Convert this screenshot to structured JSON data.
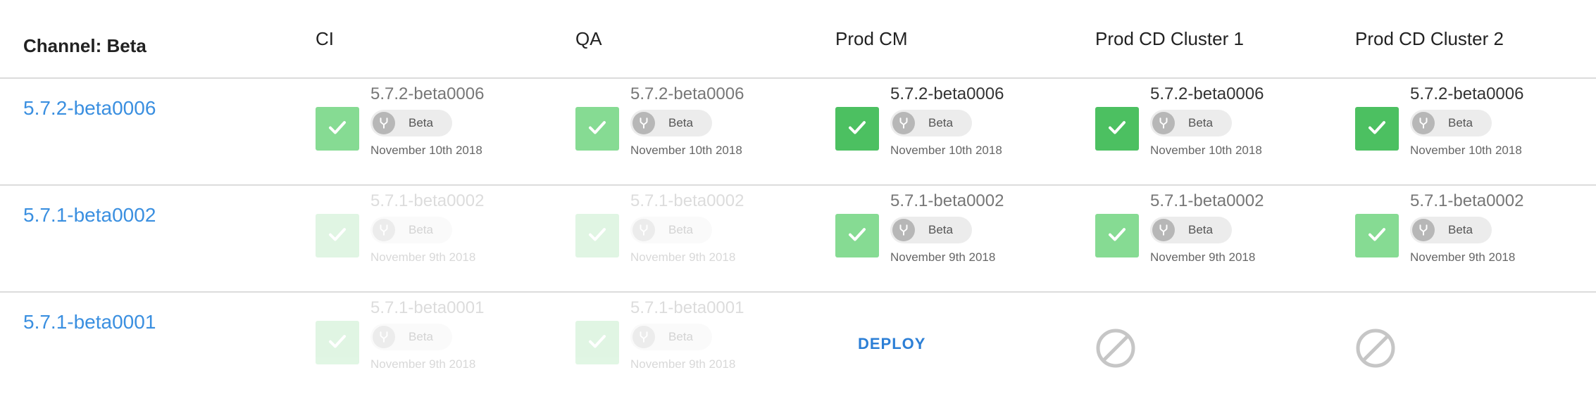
{
  "header": {
    "channel_label": "Channel: Beta",
    "columns": [
      "CI",
      "QA",
      "Prod CM",
      "Prod CD Cluster 1",
      "Prod CD Cluster 2"
    ]
  },
  "chip_label": "Beta",
  "deploy_label": "DEPLOY",
  "colors": {
    "success": "#4cc061",
    "success_light": "#86db93",
    "link": "#3a8fe0",
    "deploy": "#2c7fd6"
  },
  "icons": {
    "check": "check-icon",
    "branch": "branch-icon",
    "blocked": "no-entry-icon"
  },
  "rows": [
    {
      "version": "5.7.2-beta0006",
      "cells": [
        {
          "status": "deployed",
          "build": "5.7.2-beta0006",
          "date": "November 10th 2018"
        },
        {
          "status": "deployed",
          "build": "5.7.2-beta0006",
          "date": "November 10th 2018"
        },
        {
          "status": "deployed",
          "build": "5.7.2-beta0006",
          "date": "November 10th 2018"
        },
        {
          "status": "deployed",
          "build": "5.7.2-beta0006",
          "date": "November 10th 2018"
        },
        {
          "status": "deployed",
          "build": "5.7.2-beta0006",
          "date": "November 10th 2018"
        }
      ]
    },
    {
      "version": "5.7.1-beta0002",
      "cells": [
        {
          "status": "superseded",
          "build": "5.7.1-beta0002",
          "date": "November 9th 2018"
        },
        {
          "status": "superseded",
          "build": "5.7.1-beta0002",
          "date": "November 9th 2018"
        },
        {
          "status": "deployed",
          "build": "5.7.1-beta0002",
          "date": "November 9th 2018"
        },
        {
          "status": "deployed",
          "build": "5.7.1-beta0002",
          "date": "November 9th 2018"
        },
        {
          "status": "deployed",
          "build": "5.7.1-beta0002",
          "date": "November 9th 2018"
        }
      ]
    },
    {
      "version": "5.7.1-beta0001",
      "cells": [
        {
          "status": "superseded",
          "build": "5.7.1-beta0001",
          "date": "November 9th 2018"
        },
        {
          "status": "superseded",
          "build": "5.7.1-beta0001",
          "date": "November 9th 2018"
        },
        {
          "status": "deploy"
        },
        {
          "status": "blocked"
        },
        {
          "status": "blocked"
        }
      ]
    }
  ]
}
